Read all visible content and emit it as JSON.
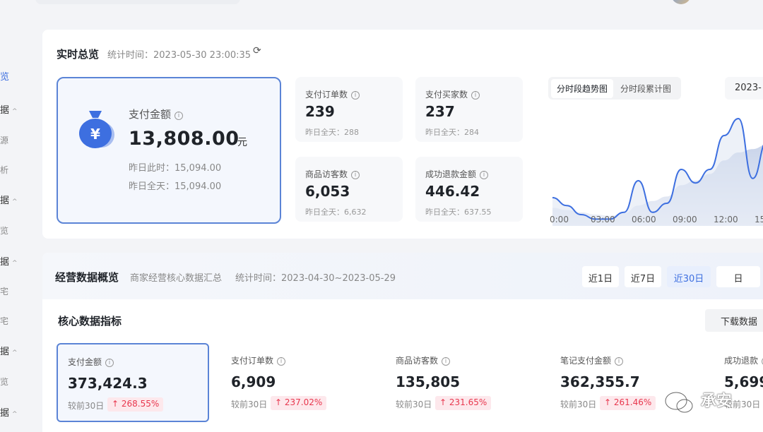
{
  "sidebar": {
    "items": [
      {
        "label": "览",
        "active": true
      },
      {
        "label": "据"
      },
      {
        "label": "源"
      },
      {
        "label": "析"
      },
      {
        "label": "据"
      },
      {
        "label": "览"
      },
      {
        "label": "据"
      },
      {
        "label": "宅"
      },
      {
        "label": "宅"
      },
      {
        "label": "据"
      },
      {
        "label": "览"
      },
      {
        "label": "据"
      }
    ]
  },
  "realtime": {
    "title": "实时总览",
    "time_label": "统计时间：2023-05-30 23:00:35",
    "pay": {
      "label": "支付金额",
      "value": "13,808.00",
      "unit": "元",
      "yesterday_now": "昨日此时：15,094.00",
      "yesterday_all": "昨日全天：15,094.00"
    },
    "metrics": [
      {
        "label": "支付订单数",
        "value": "239",
        "prev": "昨日全天：288"
      },
      {
        "label": "支付买家数",
        "value": "237",
        "prev": "昨日全天：284"
      },
      {
        "label": "商品访客数",
        "value": "6,053",
        "prev": "昨日全天：6,632"
      },
      {
        "label": "成功退款金额",
        "value": "446.42",
        "prev": "昨日全天：637.55"
      }
    ],
    "tabs": [
      "分时段趋势图",
      "分时段累计图"
    ],
    "date": "2023-"
  },
  "business": {
    "title": "经营数据概览",
    "subtitle": "商家经营核心数据汇总",
    "time_label": "统计时间：2023-04-30~2023-05-29",
    "ranges": [
      "近1日",
      "近7日",
      "近30日",
      "日"
    ],
    "core_title": "核心数据指标",
    "download": "下载数据",
    "kpis": [
      {
        "label": "支付金额",
        "value": "373,424.3",
        "cmp": "较前30日",
        "change": "↑ 268.55%"
      },
      {
        "label": "支付订单数",
        "value": "6,909",
        "cmp": "较前30日",
        "change": "↑ 237.02%"
      },
      {
        "label": "商品访客数",
        "value": "135,805",
        "cmp": "较前30日",
        "change": "↑ 231.65%"
      },
      {
        "label": "笔记支付金额",
        "value": "362,355.7",
        "cmp": "较前30日",
        "change": "↑ 261.46%"
      },
      {
        "label": "成功退款",
        "value": "5,699",
        "cmp": "较前30日",
        "change": ""
      }
    ]
  },
  "watermark": "承安",
  "colors": {
    "accent": "#3d6fe0",
    "border_active": "#5b84d6",
    "badge_red": "#e8374e"
  },
  "chart_data": {
    "type": "area",
    "x_ticks": [
      "0:00",
      "03:00",
      "06:00",
      "09:00",
      "12:00",
      "15:00"
    ],
    "series": [
      {
        "x": [
          0,
          1,
          2,
          3,
          4,
          5,
          6,
          7,
          8,
          9,
          10,
          11,
          12,
          13,
          14,
          15,
          16
        ],
        "values": [
          2.5,
          1.8,
          1.0,
          0.6,
          0.6,
          1.2,
          4.0,
          1.2,
          2.0,
          5.0,
          3.8,
          5.0,
          8.0,
          9.5,
          4.2,
          7.5,
          5.5
        ]
      },
      {
        "x": [
          0,
          1,
          2,
          3,
          4,
          5,
          6,
          7,
          8,
          9,
          10,
          11,
          12,
          13,
          14,
          15,
          16
        ],
        "values": [
          1.6,
          1.4,
          1.2,
          1.0,
          0.9,
          1.1,
          1.8,
          2.2,
          2.6,
          3.6,
          4.0,
          4.6,
          5.8,
          6.5,
          6.8,
          7.2,
          7.0
        ]
      }
    ],
    "xlim": [
      0,
      16
    ],
    "ylim": [
      0,
      10
    ]
  }
}
